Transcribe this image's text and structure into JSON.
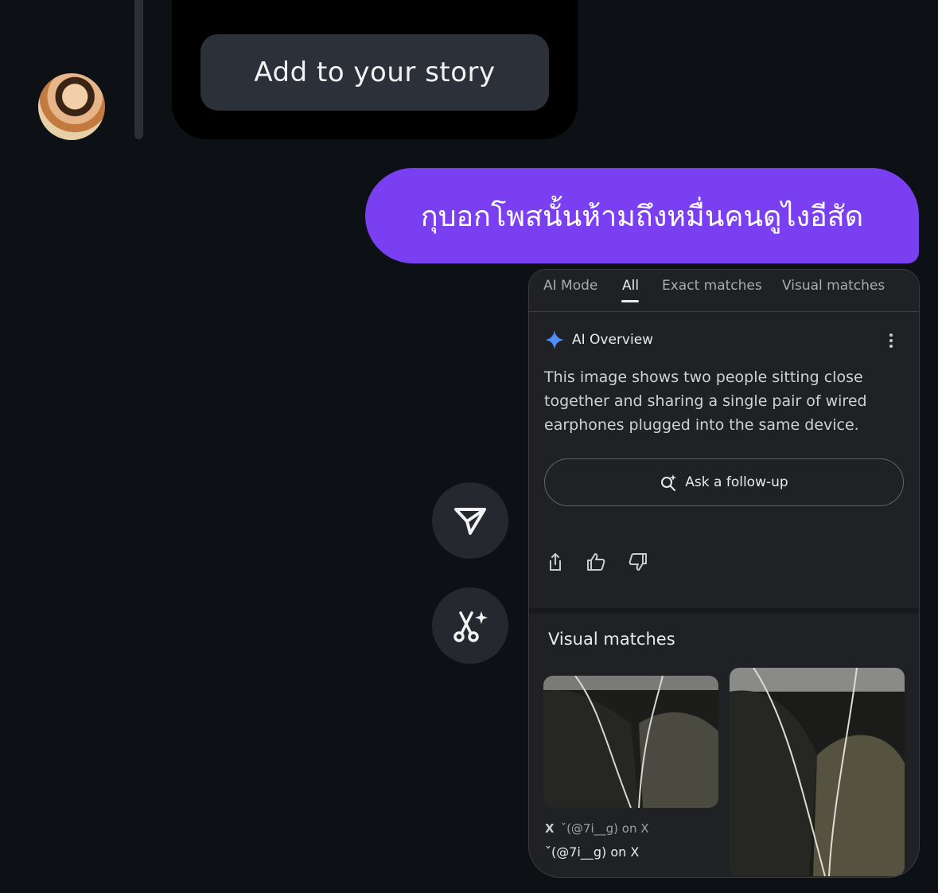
{
  "story": {
    "add_button_label": "Add to your story"
  },
  "message": {
    "text": "กุบอกโพสนั้นห้ามถึงหมื่นคนดูไงอีสัด"
  },
  "actions": [
    {
      "icon": "send-icon"
    },
    {
      "icon": "ai-remix-icon"
    }
  ],
  "screenshot": {
    "tabs": [
      "AI Mode",
      "All",
      "Exact matches",
      "Visual matches"
    ],
    "active_tab": "All",
    "ai_overview": {
      "title": "AI Overview",
      "text": "This image shows two people sitting close together and sharing a single pair of wired earphones plugged into the same device.",
      "follow_up_label": "Ask a follow-up"
    },
    "visual_matches": {
      "title": "Visual matches",
      "source_line_1": "ˇ(@7i__g) on X",
      "source_line_2": "ˇ(@7i__g) on X"
    }
  },
  "colors": {
    "background": "#0d1116",
    "bubble": "#7b3ff2",
    "story_button": "#2c3038",
    "action_button": "#25292f",
    "sparkle": "#4f8df7"
  }
}
